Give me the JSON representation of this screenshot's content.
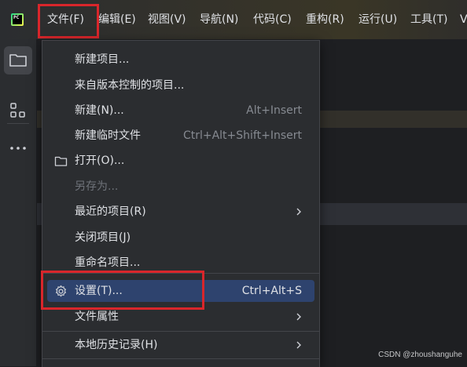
{
  "menubar": {
    "items": [
      {
        "label": "文件(F)"
      },
      {
        "label": "编辑(E)"
      },
      {
        "label": "视图(V)"
      },
      {
        "label": "导航(N)"
      },
      {
        "label": "代码(C)"
      },
      {
        "label": "重构(R)"
      },
      {
        "label": "运行(U)"
      },
      {
        "label": "工具(T)"
      },
      {
        "label": "V"
      }
    ]
  },
  "logo_text": "PC",
  "file_menu": {
    "items": [
      {
        "label": "新建项目..."
      },
      {
        "label": "来自版本控制的项目..."
      },
      {
        "label": "新建(N)...",
        "shortcut": "Alt+Insert"
      },
      {
        "label": "新建临时文件",
        "shortcut": "Ctrl+Alt+Shift+Insert"
      },
      {
        "label": "打开(O)...",
        "icon": "folder-icon"
      },
      {
        "label": "另存为...",
        "disabled": true
      },
      {
        "label": "最近的项目(R)",
        "submenu": true
      },
      {
        "label": "关闭项目(J)"
      },
      {
        "label": "重命名项目..."
      },
      {
        "label": "设置(T)...",
        "shortcut": "Ctrl+Alt+S",
        "icon": "gear-icon",
        "selected": true
      },
      {
        "label": "文件属性",
        "submenu": true
      },
      {
        "label": "本地历史记录(H)",
        "submenu": true
      }
    ]
  },
  "colors": {
    "highlight_box": "#d9262b",
    "selected_item": "#2e436e",
    "menu_background": "#2b2d30"
  },
  "watermark": "CSDN @zhoushanguhe"
}
